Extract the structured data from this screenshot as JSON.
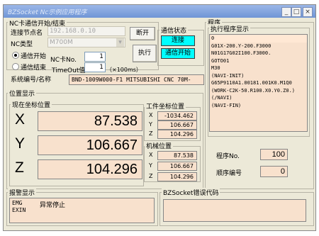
{
  "window": {
    "title": "BZSocket Nc示例应用程序",
    "buttons": {
      "min": "_",
      "max": "□",
      "close": "×"
    }
  },
  "comm": {
    "group_label": "NC卡通信开始/结束",
    "node_label": "连接节点名",
    "node_value": "192.168.0.10",
    "nctype_label": "NC类型",
    "nctype_value": "M700M",
    "disconnect_label": "断开",
    "start_label": "通信开始",
    "end_label": "通信结束",
    "ncno_label": "NC卡No.",
    "ncno_value": "1",
    "timeout_label": "TimeOut值",
    "timeout_value": "1",
    "timeout_unit": "（×100ms）",
    "execute_label": "执行",
    "system_label": "系统编号/名称",
    "system_value": "BND-1009W000-F1 MITSUBISHI CNC 70M-"
  },
  "status": {
    "group_label": "通信状态",
    "connected": "连接",
    "comm_started": "通信开始"
  },
  "program": {
    "group_label": "程序",
    "exec_label": "执行程序显示",
    "lines": [
      "0",
      "G01X-200.Y-200.F3000",
      "N01G17G02I100.F3000.",
      "GOTO01",
      "M30",
      "(NAVI-INIT)",
      "G65P9110A1.00181.001K0.M1Q0",
      "(WORK-C2K-50.R100.X0.Y0.Z0.)",
      "(/NAVI)",
      "(NAVI-FIN)"
    ],
    "prog_no_label": "程序No.",
    "prog_no_value": "100",
    "seq_label": "顺序编号",
    "seq_value": "0"
  },
  "position": {
    "group_label": "位置显示",
    "current_label": "现在坐标位置",
    "current": [
      {
        "axis": "X",
        "value": "87.538"
      },
      {
        "axis": "Y",
        "value": "106.667"
      },
      {
        "axis": "Z",
        "value": "104.296"
      }
    ],
    "work_label": "工件坐标位置",
    "work": [
      {
        "axis": "X",
        "value": "-1034.462"
      },
      {
        "axis": "Y",
        "value": "106.667"
      },
      {
        "axis": "Z",
        "value": "104.296"
      }
    ],
    "machine_label": "机械位置",
    "machine": [
      {
        "axis": "X",
        "value": "87.538"
      },
      {
        "axis": "Y",
        "value": "106.667"
      },
      {
        "axis": "Z",
        "value": "104.296"
      }
    ]
  },
  "alarm": {
    "group_label": "报警显示",
    "code1": "EMG",
    "code2": "EXIN",
    "message": "异常停止"
  },
  "error": {
    "group_label": "BZSocket错误代码"
  },
  "colors": {
    "field": "#f8e1cd",
    "status": "#00ffff",
    "window": "#ece9d8"
  }
}
